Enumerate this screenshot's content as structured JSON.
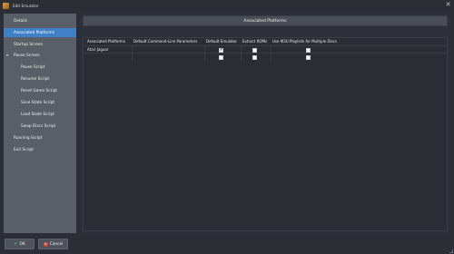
{
  "window": {
    "title": "Edit Emulator",
    "close_glyph": "✕"
  },
  "sidebar": {
    "items": [
      {
        "label": "Details"
      },
      {
        "label": "Associated Platforms",
        "selected": true
      },
      {
        "label": "Startup Screen"
      },
      {
        "label": "Pause Screen",
        "toggle": "▾"
      },
      {
        "label": "Pause Script"
      },
      {
        "label": "Resume Script"
      },
      {
        "label": "Reset Game Script"
      },
      {
        "label": "Save State Script"
      },
      {
        "label": "Load State Script"
      },
      {
        "label": "Swap Discs Script"
      },
      {
        "label": "Running Script"
      },
      {
        "label": "Exit Script"
      }
    ]
  },
  "main": {
    "header": "Associated Platforms",
    "columns": [
      "Associated Platforms",
      "Default Command-Line Parameters",
      "Default Emulator",
      "Extract ROMs",
      "Use M3U Playlists for Multiple Discs"
    ],
    "rows": [
      {
        "platform": "Atari Jaguar",
        "params": "",
        "default_emulator": true,
        "extract_roms": false,
        "use_m3u": false
      },
      {
        "platform": "",
        "params": "",
        "default_emulator": false,
        "extract_roms": false,
        "use_m3u": false
      }
    ]
  },
  "buttons": {
    "ok": "OK",
    "cancel": "Cancel"
  },
  "icons": {
    "check": "✔",
    "cancel_x": "✕"
  }
}
